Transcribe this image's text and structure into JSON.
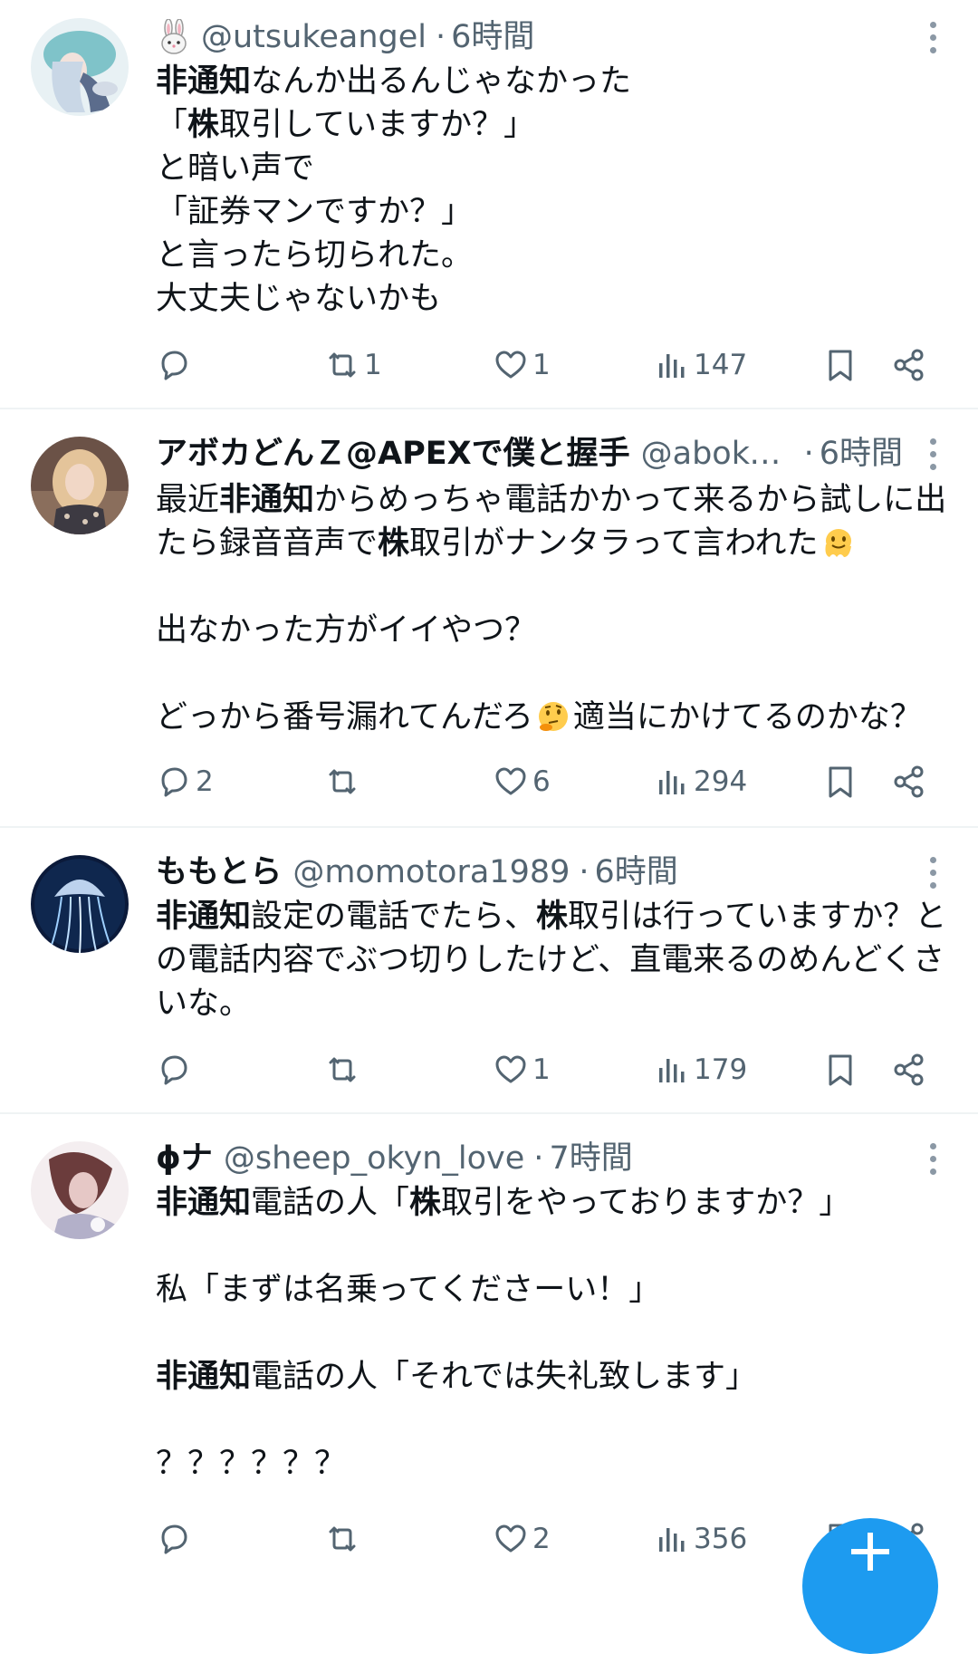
{
  "tweets": [
    {
      "name": "",
      "handle": "@utsukeangel",
      "time": "6時間",
      "badge_icon": "rabbit-emoji",
      "lines": [
        [
          {
            "b": "非通知"
          },
          {
            "t": "なんか出るんじゃなかった"
          }
        ],
        [
          {
            "t": "「"
          },
          {
            "b": "株"
          },
          {
            "t": "取引していますか？」"
          }
        ],
        [
          {
            "t": "と暗い声で"
          }
        ],
        [
          {
            "t": "「証券マンですか？」"
          }
        ],
        [
          {
            "t": "と言ったら切られた。"
          }
        ],
        [
          {
            "t": "大丈夫じゃないかも"
          }
        ]
      ],
      "reply_count": "",
      "retweet_count": "1",
      "like_count": "1",
      "view_count": "147"
    },
    {
      "name": "アボカどんＺ@APEXで僕と握手",
      "handle": "@aboka...",
      "time": "6時間",
      "badge_icon": "",
      "lines": [
        [
          {
            "t": "最近"
          },
          {
            "b": "非通知"
          },
          {
            "t": "からめっちゃ電話かかって来るから試しに出"
          }
        ],
        [
          {
            "t": "たら録音音声で"
          },
          {
            "b": "株"
          },
          {
            "t": "取引がナンタラって言われた"
          },
          {
            "e": "melting-face-emoji"
          }
        ],
        [],
        [
          {
            "t": "出なかった方がイイやつ？"
          }
        ],
        [],
        [
          {
            "t": "どっから番号漏れてんだろ"
          },
          {
            "e": "thinking-face-emoji"
          },
          {
            "t": "適当にかけてるのかな？"
          }
        ]
      ],
      "reply_count": "2",
      "retweet_count": "",
      "like_count": "6",
      "view_count": "294"
    },
    {
      "name": "ももとら",
      "handle": "@momotora1989",
      "time": "6時間",
      "badge_icon": "",
      "lines": [
        [
          {
            "b": "非通知"
          },
          {
            "t": "設定の電話でたら、"
          },
          {
            "b": "株"
          },
          {
            "t": "取引は行っていますか？と"
          }
        ],
        [
          {
            "t": "の電話内容でぶつ切りしたけど、直電来るのめんどくさ"
          }
        ],
        [
          {
            "t": "いな。"
          }
        ]
      ],
      "reply_count": "",
      "retweet_count": "",
      "like_count": "1",
      "view_count": "179"
    },
    {
      "name": "ϕナ",
      "handle": "@sheep_okyn_love",
      "time": "7時間",
      "badge_icon": "",
      "lines": [
        [
          {
            "b": "非通知"
          },
          {
            "t": "電話の人「"
          },
          {
            "b": "株"
          },
          {
            "t": "取引をやっておりますか？」"
          }
        ],
        [],
        [
          {
            "t": "私「まずは名乗ってくださーい！」"
          }
        ],
        [],
        [
          {
            "b": "非通知"
          },
          {
            "t": "電話の人「それでは失礼致します」"
          }
        ],
        [],
        [
          {
            "t": "？？？？？？"
          }
        ]
      ],
      "reply_count": "",
      "retweet_count": "",
      "like_count": "2",
      "view_count": "356"
    }
  ],
  "colors": {
    "text": "#0f1419",
    "secondary": "#536471",
    "divider": "#eff3f4",
    "accent": "#1d9bf0"
  },
  "icons": [
    "reply-icon",
    "retweet-icon",
    "like-icon",
    "views-icon",
    "bookmark-icon",
    "share-icon",
    "more-icon",
    "compose-icon"
  ]
}
